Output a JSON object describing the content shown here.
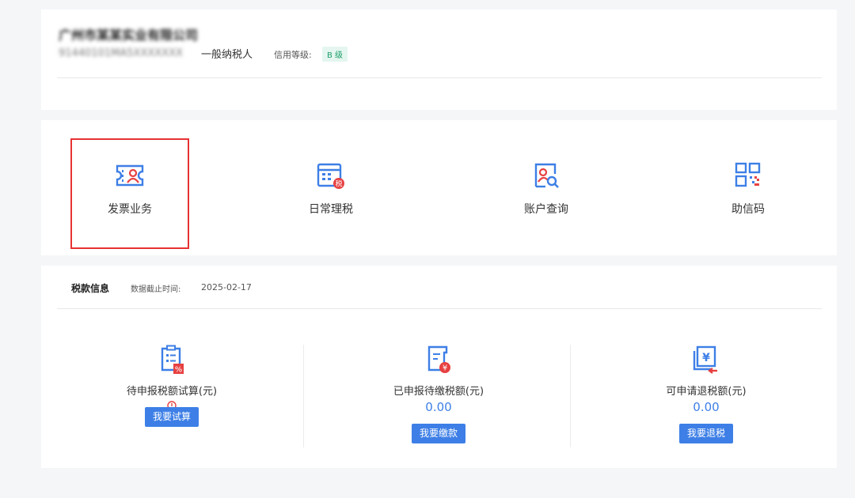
{
  "header": {
    "company_name": "广州市某某实业有限公司",
    "company_id": "91440101MA5XXXXXXX",
    "taxpayer_type": "一般纳税人",
    "credit_label": "信用等级:",
    "credit_grade": "B 级"
  },
  "services": [
    {
      "label": "发票业务",
      "icon": "invoice-icon",
      "selected": true
    },
    {
      "label": "日常理税",
      "icon": "tax-calendar-icon"
    },
    {
      "label": "账户查询",
      "icon": "account-search-icon"
    },
    {
      "label": "助信码",
      "icon": "qr-code-icon"
    }
  ],
  "tax_info": {
    "title": "税款信息",
    "date_label": "数据截止时间:",
    "date": "2025-02-17",
    "columns": [
      {
        "label": "待申报税额试算(元)",
        "value": "",
        "button": "我要试算",
        "icon": "clipboard-percent-icon"
      },
      {
        "label": "已申报待缴税额(元)",
        "value": "0.00",
        "button": "我要缴款",
        "icon": "document-yuan-icon"
      },
      {
        "label": "可申请退税额(元)",
        "value": "0.00",
        "button": "我要退税",
        "icon": "refund-yuan-icon"
      }
    ]
  },
  "colors": {
    "accent": "#3d7fe6",
    "highlight": "#e73232",
    "badge": "#1d9e6a"
  }
}
